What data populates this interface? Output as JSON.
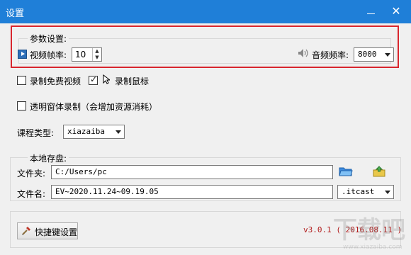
{
  "window": {
    "title": "设置",
    "minimize_glyph": "−",
    "close_glyph": "✕"
  },
  "params": {
    "group_label": "参数设置:",
    "fps_label": "视频帧率:",
    "fps_value": "10",
    "audio_label": "音频频率:",
    "audio_value": "8000"
  },
  "options": {
    "free_video_label": "录制免费视频",
    "free_video_checked": false,
    "mouse_label": "录制鼠标",
    "mouse_checked": true,
    "transparent_label": "透明窗体录制（会增加资源消耗）",
    "transparent_checked": false,
    "course_type_label": "课程类型:",
    "course_type_value": "xiazaiba"
  },
  "storage": {
    "group_label": "本地存盘:",
    "folder_label": "文件夹:",
    "folder_value": "C:/Users/pc",
    "filename_label": "文件名:",
    "filename_value": "EV~2020.11.24~09.19.05",
    "extension_value": ".itcast"
  },
  "footer": {
    "hotkey_button": "快捷键设置",
    "version": "v3.0.1 ( 2016.08.11 )"
  },
  "watermark": {
    "text": "下载吧",
    "url": "www.xiazaiba.com"
  },
  "colors": {
    "titlebar": "#1f7fd8",
    "highlight_border": "#d8262e",
    "version_text": "#b21c1c"
  }
}
